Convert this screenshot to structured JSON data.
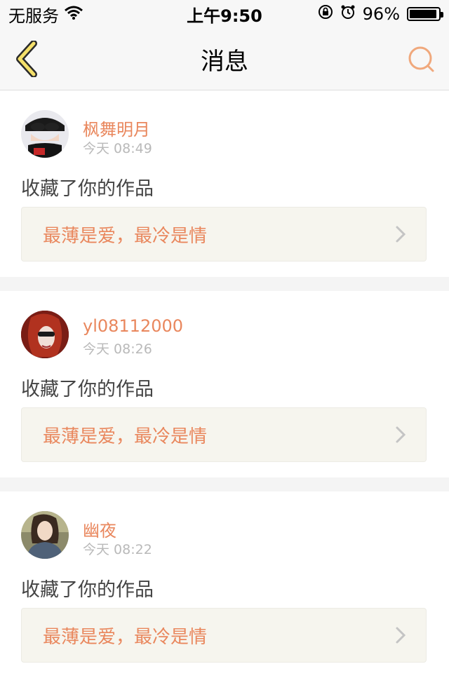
{
  "status_bar": {
    "carrier": "无服务",
    "time": "上午9:50",
    "battery_percent": "96%",
    "battery_level": 0.96
  },
  "nav": {
    "title": "消息",
    "back_icon": "chevron-left-icon",
    "search_icon": "search-icon"
  },
  "colors": {
    "accent": "#e9875d",
    "back_fill": "#f5e06a",
    "back_stroke": "#2b2b2b",
    "card_bg": "#f6f5ee"
  },
  "messages": [
    {
      "username": "枫舞明月",
      "time": "今天 08:49",
      "action": "收藏了你的作品",
      "work_title": "最薄是爱，最冷是情"
    },
    {
      "username": "yl08112000",
      "time": "今天 08:26",
      "action": "收藏了你的作品",
      "work_title": "最薄是爱，最冷是情"
    },
    {
      "username": "幽夜",
      "time": "今天 08:22",
      "action": "收藏了你的作品",
      "work_title": "最薄是爱，最冷是情"
    }
  ]
}
